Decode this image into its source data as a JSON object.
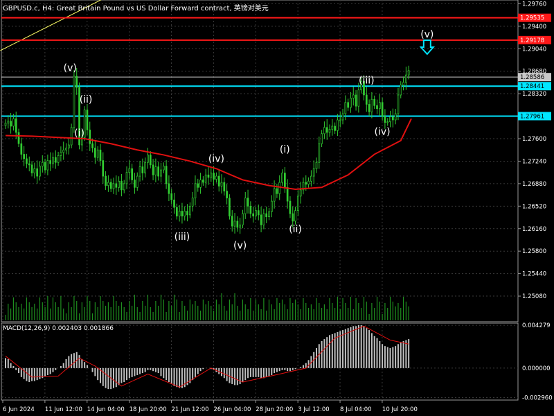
{
  "header": {
    "title": "GBPUSD.c, H4:  Great Britain Pound vs US Dollar Forward contract, 英镑对美元"
  },
  "colors": {
    "background": "#000000",
    "grid": "#3a3a3a",
    "candle": "#32cd32",
    "ma": "#e01010",
    "red_level": "#ff1818",
    "cyan_level": "#00e5ff",
    "trendline": "#ffff66",
    "wave_label": "#ffffff",
    "macd_hist": "#c0c0c0",
    "macd_signal": "#e01010",
    "arrow": "#00e5ff"
  },
  "chart_data": [
    {
      "type": "candlestick",
      "title": "GBPUSD.c, H4:  Great Britain Pound vs US Dollar Forward contract, 英镑对美元",
      "ylim": [
        1.2467,
        1.2982
      ],
      "y_tick_labels": [
        "1.29760",
        "1.29400",
        "1.29040",
        "1.28680",
        "1.28320",
        "1.27960",
        "1.27600",
        "1.27240",
        "1.26880",
        "1.26520",
        "1.26160",
        "1.25800",
        "1.25440",
        "1.25080"
      ],
      "x_tick_labels": [
        "6 Jun 2024",
        "11 Jun 12:00",
        "14 Jun 04:00",
        "18 Jun 20:00",
        "21 Jun 12:00",
        "26 Jun 04:00",
        "28 Jun 20:00",
        "3 Jul 12:00",
        "8 Jul 04:00",
        "10 Jul 20:00"
      ],
      "levels": [
        {
          "name": "red-level-1",
          "value": 1.29535,
          "label": "1.29535",
          "color": "#ff1818"
        },
        {
          "name": "red-level-2",
          "value": 1.29178,
          "label": "1.29178",
          "color": "#ff1818"
        },
        {
          "name": "current-price",
          "value": 1.28586,
          "label": "1.28586",
          "color": "#c8c8c8"
        },
        {
          "name": "cyan-level-1",
          "value": 1.28441,
          "label": "1.28441",
          "color": "#00e5ff"
        },
        {
          "name": "cyan-level-2",
          "value": 1.27961,
          "label": "1.27961",
          "color": "#00e5ff"
        }
      ],
      "close_series": [
        1.2785,
        1.2788,
        1.278,
        1.2792,
        1.277,
        1.2752,
        1.2735,
        1.2728,
        1.272,
        1.2718,
        1.2705,
        1.2712,
        1.27,
        1.2716,
        1.2722,
        1.271,
        1.2725,
        1.272,
        1.273,
        1.2722,
        1.2733,
        1.2738,
        1.2742,
        1.2745,
        1.275,
        1.2778,
        1.286,
        1.2842,
        1.275,
        1.2762,
        1.2806,
        1.2774,
        1.2752,
        1.2745,
        1.273,
        1.2742,
        1.2725,
        1.27,
        1.2685,
        1.269,
        1.268,
        1.2688,
        1.2682,
        1.2692,
        1.2678,
        1.2688,
        1.2706,
        1.2712,
        1.2694,
        1.2682,
        1.27,
        1.2715,
        1.2705,
        1.2722,
        1.2734,
        1.2718,
        1.2702,
        1.2715,
        1.27,
        1.271,
        1.2716,
        1.2688,
        1.2672,
        1.2662,
        1.265,
        1.2636,
        1.2644,
        1.2636,
        1.2644,
        1.2638,
        1.2652,
        1.2665,
        1.2688,
        1.2682,
        1.2694,
        1.269,
        1.2702,
        1.2698,
        1.2705,
        1.2695,
        1.27,
        1.2684,
        1.269,
        1.2676,
        1.2665,
        1.2636,
        1.262,
        1.2628,
        1.2618,
        1.2622,
        1.264,
        1.2665,
        1.2652,
        1.264,
        1.2636,
        1.2645,
        1.2638,
        1.2622,
        1.264,
        1.2635,
        1.2643,
        1.266,
        1.268,
        1.2672,
        1.269,
        1.2705,
        1.2682,
        1.266,
        1.264,
        1.2628,
        1.2645,
        1.2668,
        1.2678,
        1.269,
        1.2687,
        1.2692,
        1.27,
        1.2712,
        1.2722,
        1.2752,
        1.2768,
        1.2778,
        1.277,
        1.2775,
        1.278,
        1.2773,
        1.279,
        1.279,
        1.28,
        1.2818,
        1.281,
        1.2825,
        1.283,
        1.2812,
        1.2838,
        1.2852,
        1.283,
        1.2815,
        1.2803,
        1.2823,
        1.2813,
        1.2808,
        1.2818,
        1.2796,
        1.2786,
        1.2787,
        1.2795,
        1.279,
        1.28,
        1.283,
        1.2846,
        1.285,
        1.2862,
        1.2869
      ],
      "moving_average": [
        {
          "x": 0,
          "value": 1.2765
        },
        {
          "x": 10,
          "value": 1.2764
        },
        {
          "x": 20,
          "value": 1.2762
        },
        {
          "x": 30,
          "value": 1.276
        },
        {
          "x": 40,
          "value": 1.2752
        },
        {
          "x": 50,
          "value": 1.2742
        },
        {
          "x": 60,
          "value": 1.2734
        },
        {
          "x": 70,
          "value": 1.2724
        },
        {
          "x": 80,
          "value": 1.2712
        },
        {
          "x": 90,
          "value": 1.2694
        },
        {
          "x": 100,
          "value": 1.2685
        },
        {
          "x": 110,
          "value": 1.2679
        },
        {
          "x": 120,
          "value": 1.2682
        },
        {
          "x": 130,
          "value": 1.2702
        },
        {
          "x": 140,
          "value": 1.2735
        },
        {
          "x": 150,
          "value": 1.2757
        },
        {
          "x": 154,
          "value": 1.2792
        }
      ],
      "trendline": {
        "from": {
          "x": -2,
          "value": 1.2901
        },
        "to": {
          "x": 38,
          "value": 1.2986
        }
      },
      "wave_labels": [
        {
          "text": "(v)",
          "x": 24.5,
          "value": 1.2868
        },
        {
          "text": "(ii)",
          "x": 30.5,
          "value": 1.2818
        },
        {
          "text": "(i)",
          "x": 28,
          "value": 1.2764
        },
        {
          "text": "(iii)",
          "x": 67,
          "value": 1.2598
        },
        {
          "text": "(iv)",
          "x": 80,
          "value": 1.2723
        },
        {
          "text": "(v)",
          "x": 89,
          "value": 1.2584
        },
        {
          "text": "(i)",
          "x": 106,
          "value": 1.2738
        },
        {
          "text": "(ii)",
          "x": 110,
          "value": 1.261
        },
        {
          "text": "(iii)",
          "x": 137,
          "value": 1.2848
        },
        {
          "text": "(iv)",
          "x": 143,
          "value": 1.2766
        },
        {
          "text": "(v)",
          "x": 160,
          "value": 1.2922
        }
      ]
    },
    {
      "type": "bar",
      "title": "MACD(12,26,9) 0.002403 0.001866",
      "ylim": [
        -0.0032,
        0.0045
      ],
      "y_tick_labels": [
        "0.004279",
        "0.000000",
        "-0.002960"
      ],
      "histogram": [
        0.001,
        0.0009,
        0.0005,
        0.0002,
        -0.0002,
        -0.0005,
        -0.0009,
        -0.0011,
        -0.0013,
        -0.0014,
        -0.0013,
        -0.0013,
        -0.0012,
        -0.0011,
        -0.001,
        -0.0008,
        -0.0007,
        -0.0006,
        -0.0004,
        -0.0002,
        0.0,
        0.0002,
        0.0005,
        0.0009,
        0.0012,
        0.0014,
        0.0015,
        0.0016,
        0.0013,
        0.0009,
        0.0006,
        0.0003,
        0.0,
        -0.0004,
        -0.0008,
        -0.0012,
        -0.0015,
        -0.0018,
        -0.002,
        -0.0021,
        -0.0021,
        -0.002,
        -0.0019,
        -0.0017,
        -0.0015,
        -0.0014,
        -0.0012,
        -0.001,
        -0.0009,
        -0.0008,
        -0.0007,
        -0.0006,
        -0.0005,
        -0.0004,
        -0.0002,
        -0.0002,
        -0.0003,
        -0.0004,
        -0.0005,
        -0.0008,
        -0.001,
        -0.0012,
        -0.0014,
        -0.0016,
        -0.0018,
        -0.0019,
        -0.002,
        -0.002,
        -0.0019,
        -0.0017,
        -0.0015,
        -0.0012,
        -0.0009,
        -0.0006,
        -0.0003,
        -0.0001,
        0.0,
        0.0,
        -0.0001,
        -0.0002,
        -0.0004,
        -0.0006,
        -0.0008,
        -0.001,
        -0.0013,
        -0.0015,
        -0.0016,
        -0.0017,
        -0.0017,
        -0.0016,
        -0.0014,
        -0.0012,
        -0.001,
        -0.0009,
        -0.0009,
        -0.0009,
        -0.0009,
        -0.001,
        -0.001,
        -0.0009,
        -0.0008,
        -0.0007,
        -0.0005,
        -0.0004,
        -0.0003,
        -0.0002,
        -0.0002,
        -0.0003,
        -0.0003,
        -0.0002,
        -0.0001,
        0.0,
        0.0001,
        0.0003,
        0.0005,
        0.0008,
        0.0012,
        0.0016,
        0.002,
        0.0024,
        0.0027,
        0.0029,
        0.0031,
        0.0033,
        0.0034,
        0.0035,
        0.0036,
        0.0037,
        0.0038,
        0.0039,
        0.004,
        0.0041,
        0.0042,
        0.0042,
        0.0043,
        0.0043,
        0.0042,
        0.004,
        0.0038,
        0.0035,
        0.0032,
        0.003,
        0.0027,
        0.0024,
        0.0022,
        0.0021,
        0.002,
        0.0021,
        0.0022,
        0.0024,
        0.0026,
        0.0027,
        0.0028,
        0.0029
      ],
      "signal": [
        {
          "x": 0,
          "value": 0.0012
        },
        {
          "x": 10,
          "value": -0.0009
        },
        {
          "x": 20,
          "value": -0.0008
        },
        {
          "x": 28,
          "value": 0.001
        },
        {
          "x": 34,
          "value": 0.0002
        },
        {
          "x": 44,
          "value": -0.0018
        },
        {
          "x": 54,
          "value": -0.0006
        },
        {
          "x": 66,
          "value": -0.0019
        },
        {
          "x": 78,
          "value": 0.0
        },
        {
          "x": 90,
          "value": -0.0014
        },
        {
          "x": 104,
          "value": -0.0006
        },
        {
          "x": 114,
          "value": 0.0
        },
        {
          "x": 125,
          "value": 0.003
        },
        {
          "x": 136,
          "value": 0.0042
        },
        {
          "x": 146,
          "value": 0.0028
        },
        {
          "x": 153,
          "value": 0.0024
        }
      ]
    }
  ]
}
